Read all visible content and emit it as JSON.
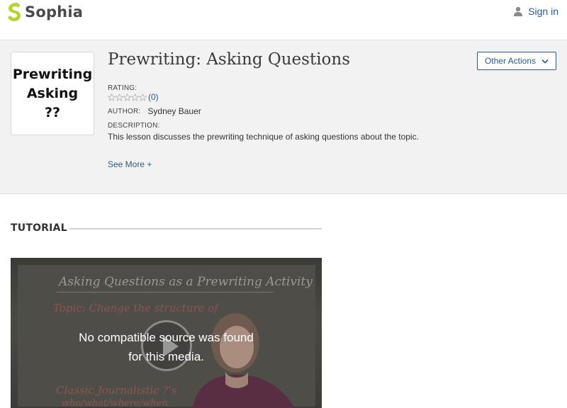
{
  "header": {
    "brand": "Sophia",
    "signin_label": "Sign in"
  },
  "lesson": {
    "thumbnail_lines": [
      "Prewriting",
      "Asking",
      "??"
    ],
    "title": "Prewriting: Asking Questions",
    "rating_label": "RATING:",
    "rating_count": "(0)",
    "rating_stars": 0,
    "author_label": "AUTHOR:",
    "author_name": "Sydney Bauer",
    "description_label": "DESCRIPTION:",
    "description": "This lesson discusses the prewriting technique of asking questions about the topic.",
    "see_more": "See More +",
    "other_actions_label": "Other Actions"
  },
  "tutorial": {
    "heading": "TUTORIAL",
    "video": {
      "message_line1": "No compatible source was found",
      "message_line2": "for this media.",
      "whiteboard_title": "Asking Questions as a Prewriting Activity",
      "whiteboard_line2": "Topic: Change the structure of",
      "whiteboard_line3": "Classic Journalistic ?'s",
      "whiteboard_line4": "who/what/where/when"
    }
  },
  "colors": {
    "brand_green": "#b5d334",
    "link_blue": "#2a5a8c",
    "panel_bg": "#f2f2f2"
  }
}
